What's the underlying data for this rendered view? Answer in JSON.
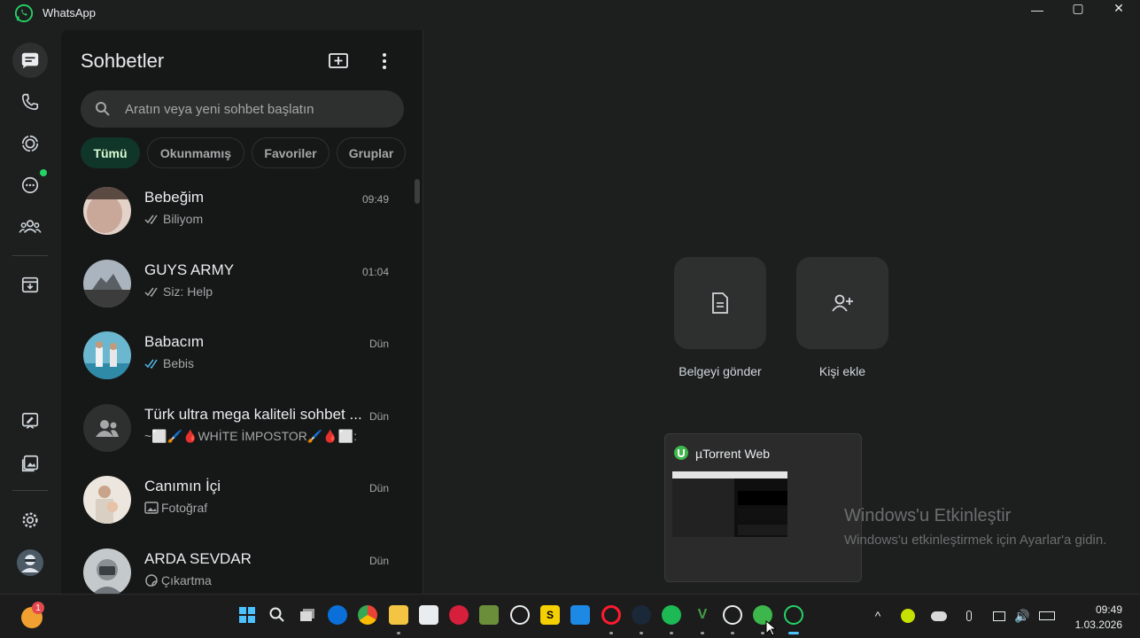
{
  "window": {
    "title": "WhatsApp",
    "controls": [
      "—",
      "▢",
      "✕"
    ]
  },
  "rail": {
    "icons": [
      "chats-icon",
      "calls-icon",
      "status-icon",
      "channels-icon",
      "communities-icon",
      "archive-icon",
      "starred-icon",
      "media-icon",
      "settings-icon",
      "profile-icon"
    ]
  },
  "panel": {
    "title": "Sohbetler",
    "search_placeholder": "Aratın veya yeni sohbet başlatın",
    "filters": [
      {
        "label": "Tümü",
        "active": true
      },
      {
        "label": "Okunmamış",
        "active": false
      },
      {
        "label": "Favoriler",
        "active": false
      },
      {
        "label": "Gruplar",
        "active": false
      }
    ],
    "chats": [
      {
        "name": "Bebeğim",
        "time": "09:49",
        "preview": "Biliyom",
        "tick": "read-grey",
        "avatar_color": "#c9b7ad"
      },
      {
        "name": "GUYS ARMY",
        "time": "01:04",
        "preview": "Siz: Help",
        "tick": "read-grey",
        "avatar_color": "#8d9aa6"
      },
      {
        "name": "Babacım",
        "time": "Dün",
        "preview": "Bebis",
        "tick": "read-blue",
        "avatar_color": "#5b9fb5"
      },
      {
        "name": "Türk ultra mega kaliteli sohbet ...",
        "time": "Dün",
        "preview": "~⬜🖌️🩸WHİTE İMPOSTOR🖌️🩸⬜:",
        "tick": "none",
        "avatar_color": "#2e2f2f"
      },
      {
        "name": "Canımın İçi",
        "time": "Dün",
        "preview": "Fotoğraf",
        "tick": "photo",
        "avatar_color": "#d8cfc4"
      },
      {
        "name": "ARDA SEVDAR",
        "time": "Dün",
        "preview": "Çıkartma",
        "tick": "sticker",
        "avatar_color": "#9aa2a8"
      }
    ]
  },
  "main": {
    "actions": [
      {
        "label": "Belgeyi gönder",
        "icon": "document-icon"
      },
      {
        "label": "Kişi ekle",
        "icon": "add-contact-icon"
      }
    ],
    "activation_title": "Windows'u Etkinleştir",
    "activation_text": "Windows'u etkinleştirmek için Ayarlar'a gidin."
  },
  "popup": {
    "title": "µTorrent Web"
  },
  "taskbar": {
    "notification_count": "1",
    "time": "09:49",
    "date": "1.03.2026",
    "apps": [
      "windows-start-icon",
      "search-icon",
      "task-view-icon",
      "edge-icon",
      "chrome-icon",
      "file-explorer-icon",
      "store-icon",
      "app-red-icon",
      "minecraft-icon",
      "obs-icon",
      "s-app-icon",
      "app-blue-icon",
      "opera-icon",
      "steam-icon",
      "spotify-icon",
      "vim-icon",
      "obs2-icon",
      "utorrent-icon",
      "whatsapp-icon"
    ]
  }
}
